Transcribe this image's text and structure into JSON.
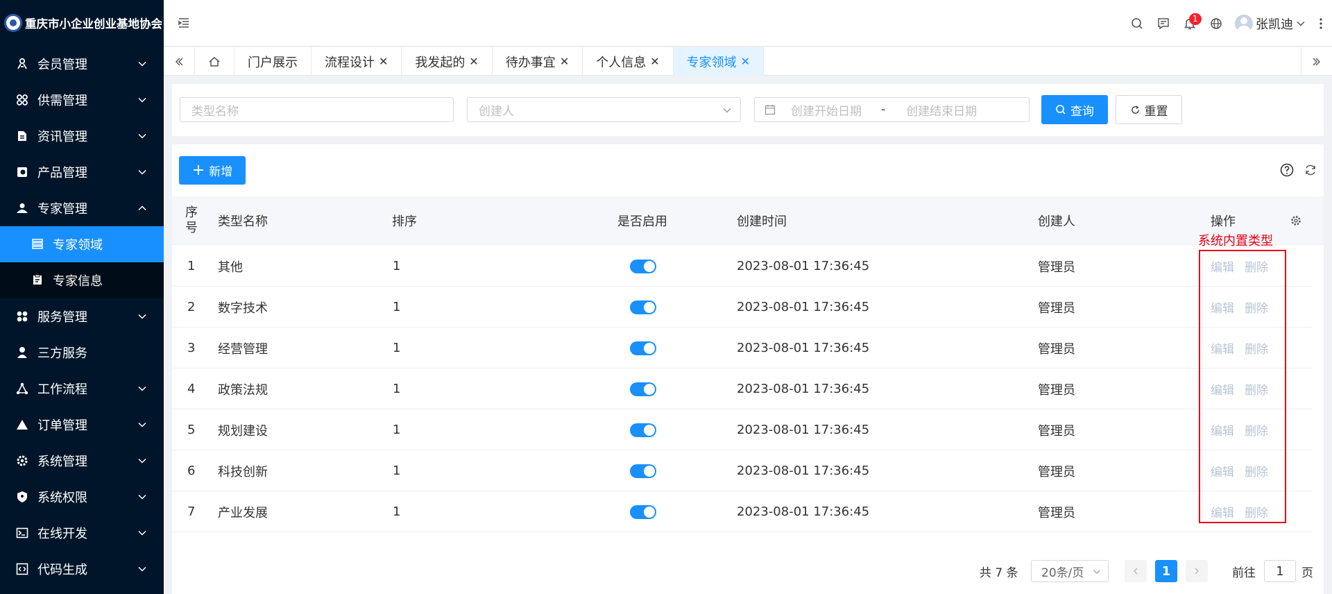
{
  "app": {
    "title": "重庆市小企业创业基地协会"
  },
  "sidebar": {
    "items": [
      {
        "label": "会员管理",
        "icon": "members-icon"
      },
      {
        "label": "供需管理",
        "icon": "supply-icon"
      },
      {
        "label": "资讯管理",
        "icon": "news-icon"
      },
      {
        "label": "产品管理",
        "icon": "product-icon"
      },
      {
        "label": "专家管理",
        "icon": "expert-icon",
        "expanded": true
      },
      {
        "label": "服务管理",
        "icon": "service-icon"
      },
      {
        "label": "三方服务",
        "icon": "third-party-icon"
      },
      {
        "label": "工作流程",
        "icon": "workflow-icon"
      },
      {
        "label": "订单管理",
        "icon": "order-icon"
      },
      {
        "label": "系统管理",
        "icon": "settings-icon"
      },
      {
        "label": "系统权限",
        "icon": "shield-icon"
      },
      {
        "label": "在线开发",
        "icon": "terminal-icon"
      },
      {
        "label": "代码生成",
        "icon": "code-icon"
      }
    ],
    "sub_items": [
      {
        "label": "专家领域",
        "active": true
      },
      {
        "label": "专家信息",
        "active": false
      }
    ]
  },
  "header": {
    "notification_count": "1",
    "user_name": "张凯迪"
  },
  "tabs": [
    {
      "label": "门户展示",
      "closable": false
    },
    {
      "label": "流程设计",
      "closable": true
    },
    {
      "label": "我发起的",
      "closable": true
    },
    {
      "label": "待办事宜",
      "closable": true
    },
    {
      "label": "个人信息",
      "closable": true
    },
    {
      "label": "专家领域",
      "closable": true,
      "active": true
    }
  ],
  "search": {
    "type_name_placeholder": "类型名称",
    "creator_placeholder": "创建人",
    "start_date_placeholder": "创建开始日期",
    "date_separator": "-",
    "end_date_placeholder": "创建结束日期",
    "query_label": "查询",
    "reset_label": "重置"
  },
  "toolbar": {
    "add_label": "新增"
  },
  "table": {
    "columns": {
      "index": "序号",
      "name": "类型名称",
      "sort": "排序",
      "enabled": "是否启用",
      "created_at": "创建时间",
      "creator": "创建人",
      "actions": "操作"
    },
    "rows": [
      {
        "index": "1",
        "name": "其他",
        "sort": "1",
        "enabled": true,
        "created_at": "2023-08-01 17:36:45",
        "creator": "管理员"
      },
      {
        "index": "2",
        "name": "数字技术",
        "sort": "1",
        "enabled": true,
        "created_at": "2023-08-01 17:36:45",
        "creator": "管理员"
      },
      {
        "index": "3",
        "name": "经营管理",
        "sort": "1",
        "enabled": true,
        "created_at": "2023-08-01 17:36:45",
        "creator": "管理员"
      },
      {
        "index": "4",
        "name": "政策法规",
        "sort": "1",
        "enabled": true,
        "created_at": "2023-08-01 17:36:45",
        "creator": "管理员"
      },
      {
        "index": "5",
        "name": "规划建设",
        "sort": "1",
        "enabled": true,
        "created_at": "2023-08-01 17:36:45",
        "creator": "管理员"
      },
      {
        "index": "6",
        "name": "科技创新",
        "sort": "1",
        "enabled": true,
        "created_at": "2023-08-01 17:36:45",
        "creator": "管理员"
      },
      {
        "index": "7",
        "name": "产业发展",
        "sort": "1",
        "enabled": true,
        "created_at": "2023-08-01 17:36:45",
        "creator": "管理员"
      }
    ],
    "edit_label": "编辑",
    "delete_label": "删除",
    "annotation": "系统内置类型"
  },
  "pagination": {
    "total_text": "共 7 条",
    "page_size": "20条/页",
    "current_page": "1",
    "goto_label": "前往",
    "goto_value": "1",
    "page_suffix": "页"
  },
  "colors": {
    "sidebar_bg": "#001529",
    "primary": "#1890ff",
    "annotation": "#e60012"
  }
}
